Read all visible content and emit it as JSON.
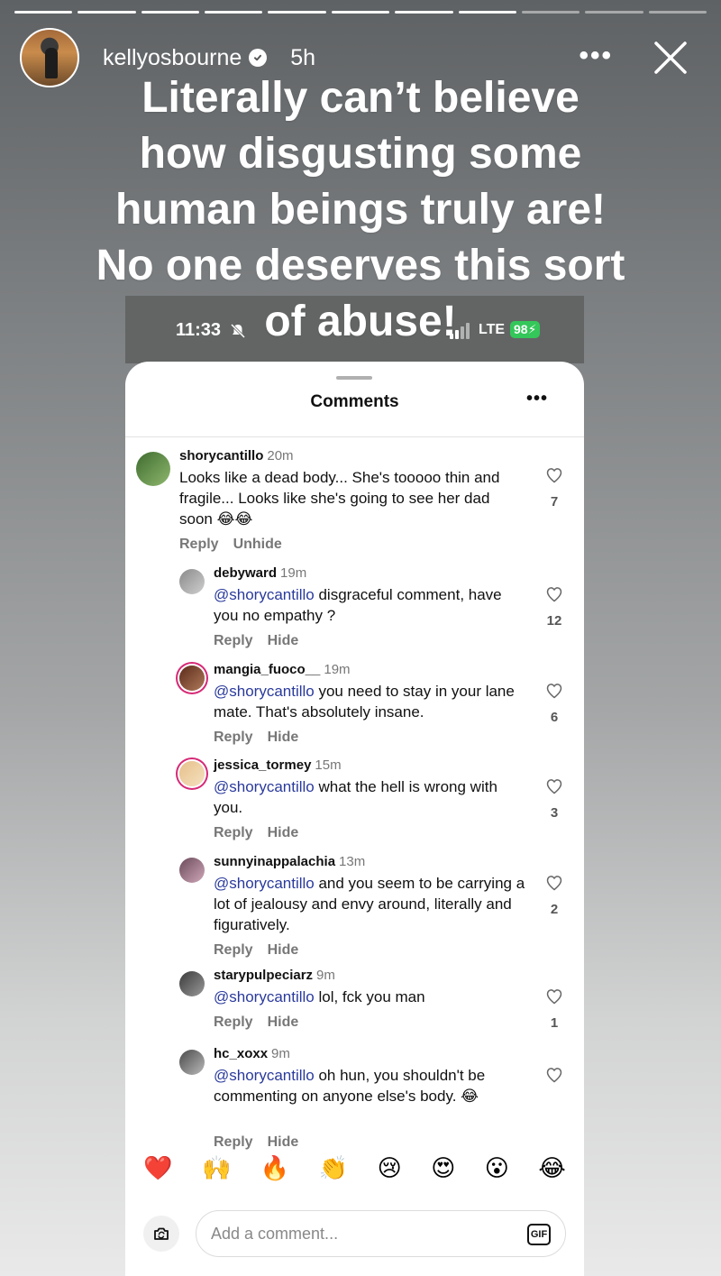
{
  "story": {
    "username": "kellyosbourne",
    "time": "5h",
    "caption_lines": [
      "Literally can’t believe",
      "how disgusting some",
      "human beings truly are!",
      "No one deserves this sort",
      "of abuse!"
    ],
    "progress_segments_total": 11,
    "progress_segments_done": 8
  },
  "screenshot": {
    "status_time": "11:33",
    "network": "LTE",
    "battery": "98",
    "title": "Comments",
    "comments": [
      {
        "user": "shorycantillo",
        "time": "20m",
        "mention": "",
        "text": "Looks like a dead body... She's tooooo thin and fragile... Looks like she's going to see her dad soon 😂😂",
        "actions": [
          "Reply",
          "Unhide"
        ],
        "likes": "7"
      },
      {
        "user": "debyward",
        "time": "19m",
        "mention": "@shorycantillo",
        "text": " disgraceful comment, have you no empathy ?",
        "actions": [
          "Reply",
          "Hide"
        ],
        "likes": "12"
      },
      {
        "user": "mangia_fuoco__",
        "time": "19m",
        "mention": "@shorycantillo",
        "text": " you need to stay in your lane mate. That's absolutely insane.",
        "actions": [
          "Reply",
          "Hide"
        ],
        "likes": "6"
      },
      {
        "user": "jessica_tormey",
        "time": "15m",
        "mention": "@shorycantillo",
        "text": " what the hell is wrong with you.",
        "actions": [
          "Reply",
          "Hide"
        ],
        "likes": "3"
      },
      {
        "user": "sunnyinappalachia",
        "time": "13m",
        "mention": "@shorycantillo",
        "text": " and you seem to be carrying a lot of jealousy and envy around, literally and figuratively.",
        "actions": [
          "Reply",
          "Hide"
        ],
        "likes": "2"
      },
      {
        "user": "starypulpeciarz",
        "time": "9m",
        "mention": "@shorycantillo",
        "text": " lol, fck you man",
        "actions": [
          "Reply",
          "Hide"
        ],
        "likes": "1"
      },
      {
        "user": "hc_xoxx",
        "time": "9m",
        "mention": "@shorycantillo",
        "text": " oh hun, you shouldn't be commenting on anyone else's body. 😂",
        "actions": [
          "Reply",
          "Hide"
        ],
        "likes": ""
      }
    ],
    "reactions": [
      "❤️",
      "🙌",
      "🔥",
      "👏",
      "😢",
      "😍",
      "😮",
      "😂"
    ],
    "reaction_names": [
      "heart-icon",
      "raised-hands-icon",
      "fire-icon",
      "clap-icon",
      "crying-icon",
      "heart-eyes-icon",
      "surprised-icon",
      "laughing-icon"
    ],
    "compose_placeholder": "Add a comment...",
    "gif_label": "GIF"
  }
}
